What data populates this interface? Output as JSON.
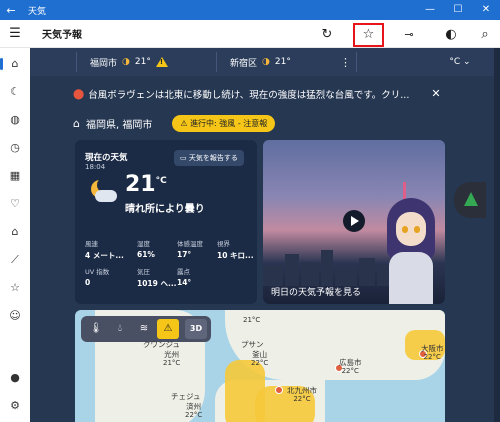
{
  "window": {
    "title": "天気",
    "back_glyph": "←",
    "controls": [
      "—",
      "☐",
      "✕"
    ]
  },
  "toolbar": {
    "title": "天気予報",
    "icons": [
      "refresh-icon",
      "star-icon",
      "pin-icon",
      "moon-icon",
      "search-icon"
    ],
    "highlight_color": "#e8141b"
  },
  "leftnav": {
    "items": [
      "home-icon",
      "forecast-icon",
      "maps-icon",
      "history-icon",
      "calendar-icon",
      "favorites-icon",
      "lifestyle-icon",
      "trends-icon",
      "news-icon",
      "feedback-icon"
    ],
    "bottom": [
      "account-icon",
      "settings-icon"
    ]
  },
  "locations": [
    {
      "name": "福岡市",
      "temp": "21°",
      "warning": true
    },
    {
      "name": "新宿区",
      "temp": "21°",
      "warning": false
    }
  ],
  "unit": "°C",
  "alert": {
    "text": "台風ボラヴェンは北東に移動し続け、現在の強度は猛烈な台風です。クリ..."
  },
  "place": {
    "name": "福岡県, 福岡市",
    "status": "進行中: 強風 - 注意報"
  },
  "current": {
    "title": "現在の天気",
    "time": "18:04",
    "report_button": "天気を報告する",
    "temp": "21",
    "unit": "°C",
    "condition": "晴れ所により曇り",
    "stats": [
      {
        "label": "風速",
        "value": "4 メート..."
      },
      {
        "label": "湿度",
        "value": "61%"
      },
      {
        "label": "体感温度",
        "value": "17°"
      },
      {
        "label": "視界",
        "value": "10 キロ..."
      },
      {
        "label": "UV 指数",
        "value": "0"
      },
      {
        "label": "気圧",
        "value": "1019 ヘ..."
      },
      {
        "label": "露点",
        "value": "14°"
      }
    ]
  },
  "video": {
    "caption": "明日の天気予報を見る"
  },
  "map": {
    "threed_label": "3D",
    "labels": [
      {
        "name": "",
        "temp": "21°C"
      },
      {
        "name": "クワンジュ",
        "temp": ""
      },
      {
        "name": "光州",
        "temp": "21°C"
      },
      {
        "name": "プサン",
        "temp": ""
      },
      {
        "name": "釜山",
        "temp": "22°C"
      },
      {
        "name": "広島市",
        "temp": "22°C"
      },
      {
        "name": "大阪市",
        "temp": "22°C"
      },
      {
        "name": "北九州市",
        "temp": "22°C"
      },
      {
        "name": "チェジュ",
        "temp": ""
      },
      {
        "name": "済州",
        "temp": "22°C"
      }
    ]
  },
  "colors": {
    "titlebar": "#1f6fd1",
    "main_bg": "#263752",
    "warning": "#f5c518"
  }
}
